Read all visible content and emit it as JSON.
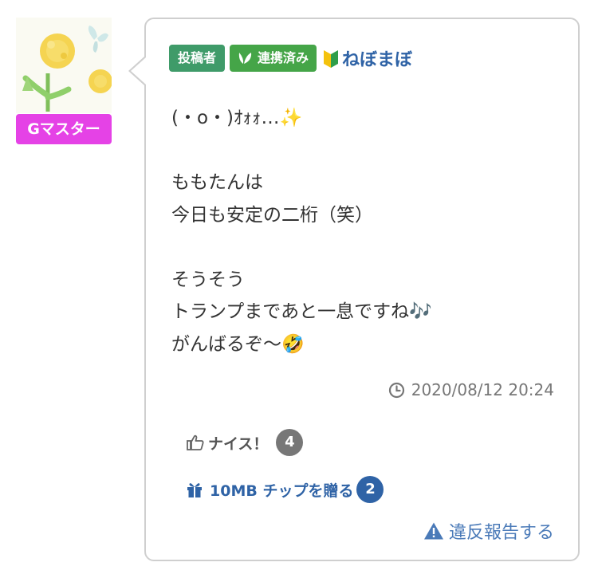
{
  "author": {
    "rank_badge": "Gマスター",
    "rank_color": "#e542e6",
    "avatar_icon": "dandelion-butterfly-avatar"
  },
  "header": {
    "poster_tag": "投稿者",
    "linked_tag": "連携済み",
    "beginner_icon": "beginner-mark-icon",
    "username": "ねぼまぼ"
  },
  "post": {
    "lines": [
      "(・o・)ｵｫｫ…✨",
      "",
      "ももたんは",
      "今日も安定の二桁（笑）",
      "",
      "そうそう",
      "トランプまであと一息ですね🎶",
      "がんばるぞ〜🤣"
    ],
    "timestamp": "2020/08/12 20:24"
  },
  "actions": {
    "nice_label": "ナイス！",
    "nice_count": "4",
    "chip_label": "10MB チップを贈る",
    "chip_count": "2",
    "report_label": "違反報告する"
  },
  "colors": {
    "link_blue": "#2f63a6",
    "tag_green": "#3f9b69",
    "linked_green": "#45a548",
    "muted_gray": "#777777"
  }
}
